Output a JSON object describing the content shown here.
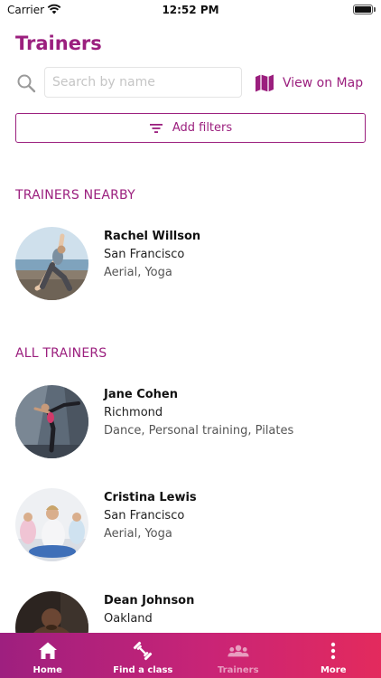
{
  "status_bar": {
    "carrier": "Carrier",
    "time": "12:52 PM",
    "battery_level": 1.0
  },
  "header": {
    "title": "Trainers"
  },
  "search": {
    "icon": "search-icon",
    "placeholder": "Search by name",
    "value": ""
  },
  "map_link": {
    "icon": "map-icon",
    "label": "View on Map"
  },
  "filters": {
    "icon": "filter-icon",
    "label": "Add filters"
  },
  "sections": {
    "nearby_title": "TRAINERS NEARBY",
    "all_title": "ALL TRAINERS"
  },
  "nearby_trainers": [
    {
      "name": "Rachel Willson",
      "city": "San Francisco",
      "tags": "Aerial, Yoga"
    }
  ],
  "all_trainers": [
    {
      "name": "Jane Cohen",
      "city": "Richmond",
      "tags": "Dance, Personal training, Pilates"
    },
    {
      "name": "Cristina Lewis",
      "city": "San Francisco",
      "tags": "Aerial, Yoga"
    },
    {
      "name": "Dean Johnson",
      "city": "Oakland",
      "tags": ""
    }
  ],
  "tab_bar": {
    "tabs": [
      {
        "label": "Home",
        "icon": "home-icon",
        "active": false
      },
      {
        "label": "Find a class",
        "icon": "dumbbell-icon",
        "active": false
      },
      {
        "label": "Trainers",
        "icon": "people-icon",
        "active": true
      },
      {
        "label": "More",
        "icon": "more-vertical-icon",
        "active": false
      }
    ]
  },
  "colors": {
    "accent": "#9b1f7e",
    "tab_gradient_start": "#9e1f7f",
    "tab_gradient_end": "#e32a5d"
  }
}
